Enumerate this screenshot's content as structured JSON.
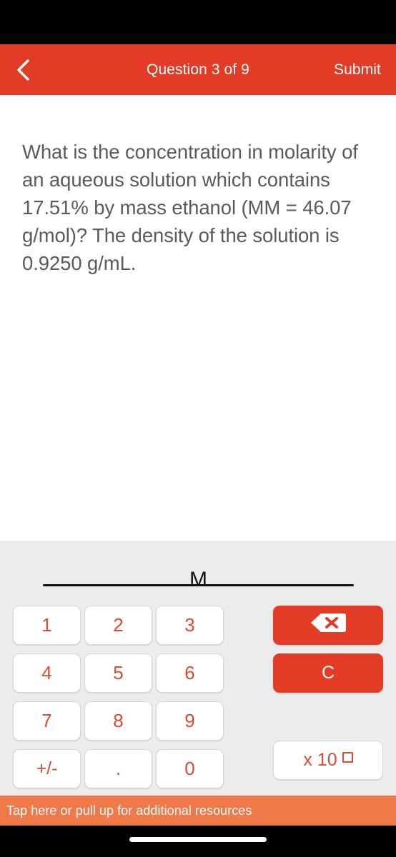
{
  "header": {
    "back_icon": "chevron-left-icon",
    "title": "Question 3 of 9",
    "submit_label": "Submit",
    "background_color": "#E23B26",
    "text_color": "#FFFFFF"
  },
  "question": {
    "text": "What is the concentration in molarity of an aqueous solution which contains 17.51% by mass ethanol (MM = 46.07 g/mol)? The density of the solution is 0.9250 g/mL.",
    "text_color": "#5A5A5A"
  },
  "answer": {
    "value": "",
    "unit": "M"
  },
  "keypad": {
    "keys": [
      {
        "label": "1",
        "name": "key-1"
      },
      {
        "label": "2",
        "name": "key-2"
      },
      {
        "label": "3",
        "name": "key-3"
      },
      {
        "label": "4",
        "name": "key-4"
      },
      {
        "label": "5",
        "name": "key-5"
      },
      {
        "label": "6",
        "name": "key-6"
      },
      {
        "label": "7",
        "name": "key-7"
      },
      {
        "label": "8",
        "name": "key-8"
      },
      {
        "label": "9",
        "name": "key-9"
      },
      {
        "label": "+/-",
        "name": "key-plus-minus"
      },
      {
        "label": ".",
        "name": "key-decimal"
      },
      {
        "label": "0",
        "name": "key-0"
      }
    ],
    "key_text_color": "#D94B32",
    "key_background": "#FFFFFF",
    "panel_background": "#ECECEC"
  },
  "actions": {
    "backspace_icon": "backspace-icon",
    "clear_label": "C",
    "exponent_label": "x 10",
    "exponent_placeholder": "square-placeholder",
    "action_background": "#E23B26"
  },
  "banner": {
    "text": "Tap here or pull up for additional resources",
    "background_color": "#F0794A",
    "text_color": "#FFFFFF"
  }
}
